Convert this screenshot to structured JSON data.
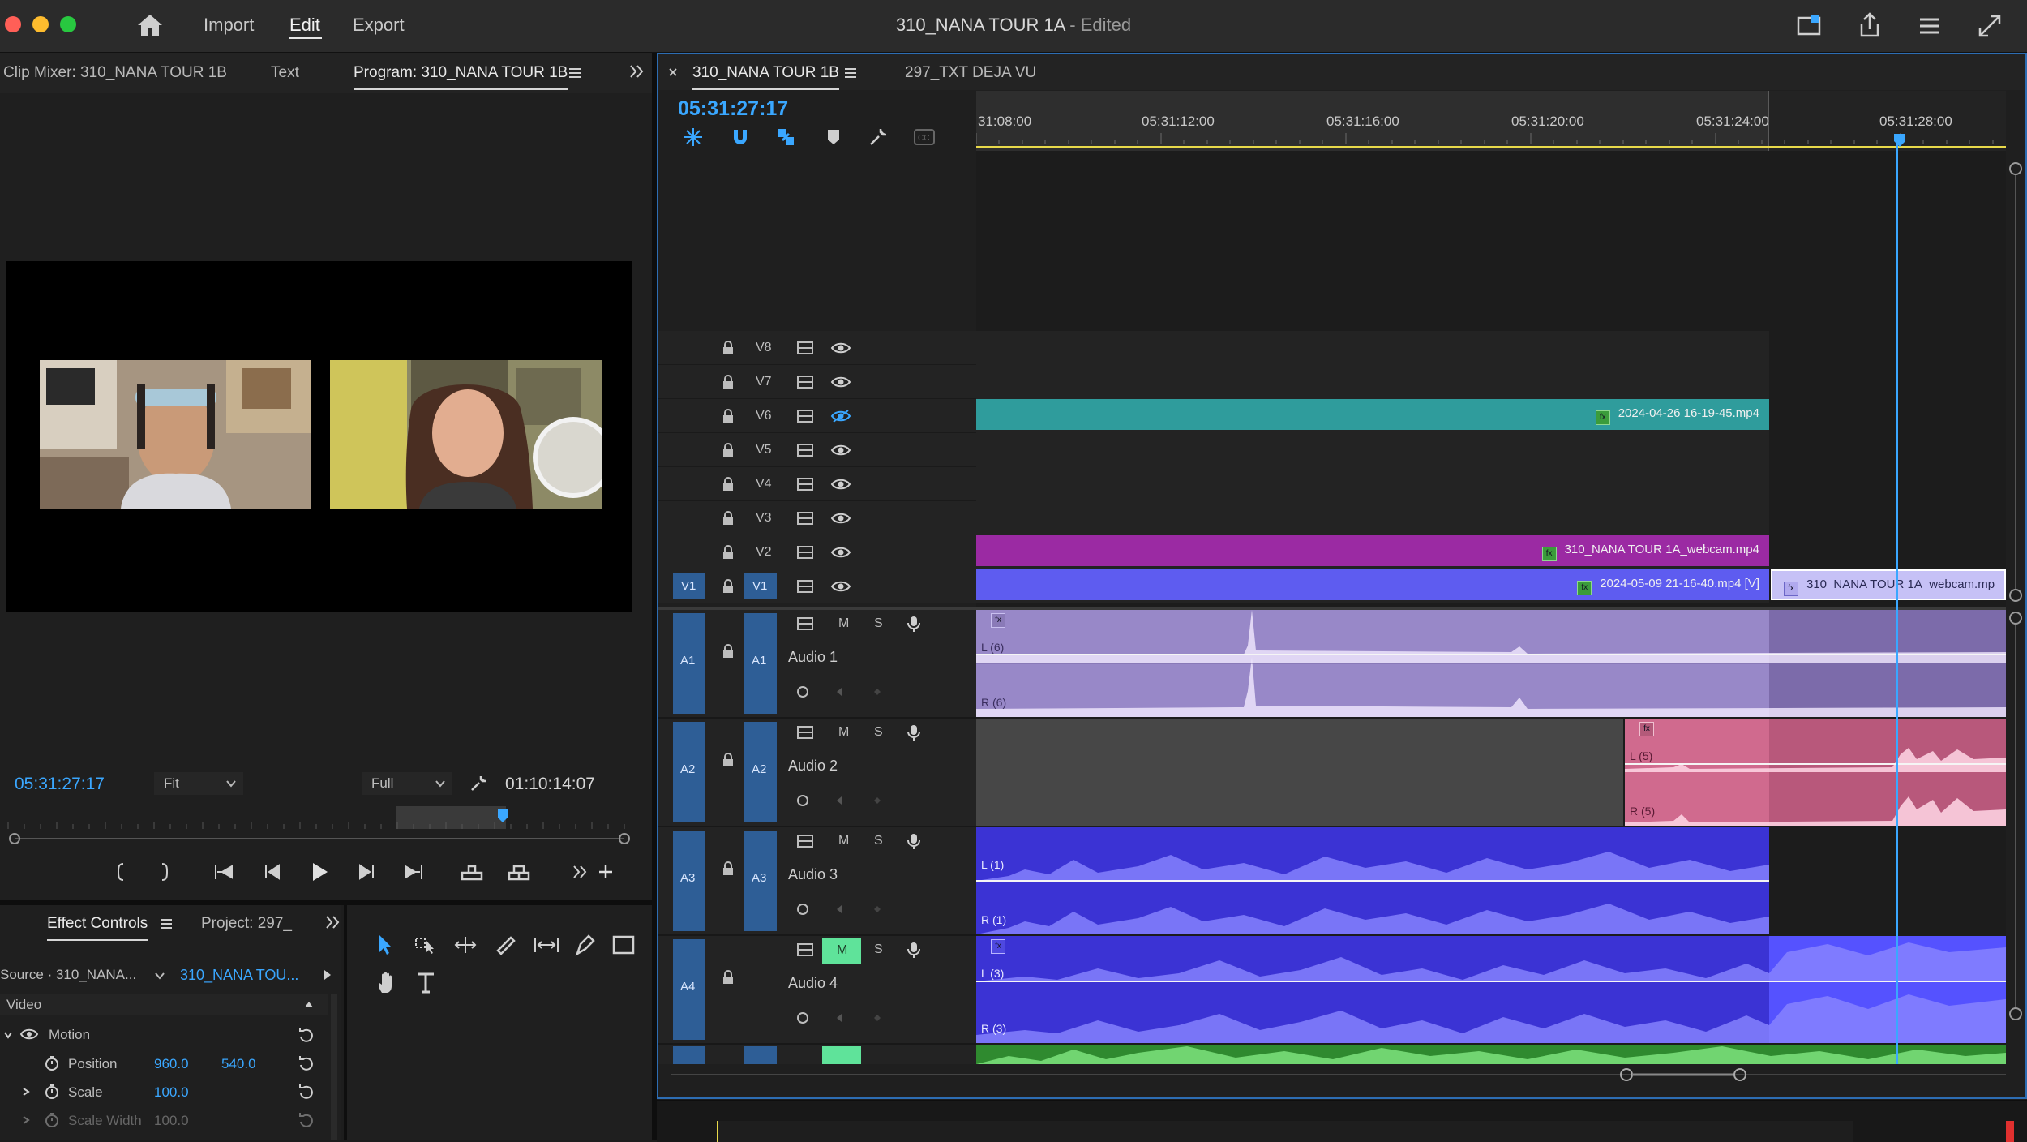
{
  "window": {
    "title": "310_NANA TOUR 1A",
    "title_suffix": "- Edited",
    "menu": [
      "Import",
      "Edit",
      "Export"
    ],
    "active_menu": "Edit"
  },
  "left_panel": {
    "tabs": [
      "Clip Mixer: 310_NANA TOUR 1B",
      "Text",
      "Program: 310_NANA TOUR 1B"
    ],
    "active_tab": "Program: 310_NANA TOUR 1B",
    "timecode": "05:31:27:17",
    "fit_value": "Fit",
    "quality_value": "Full",
    "duration": "01:10:14:07"
  },
  "effect_controls": {
    "tabs": [
      "Effect Controls",
      "Project: 297_"
    ],
    "source_label": "Source · 310_NANA...",
    "sequence_label": "310_NANA TOU...",
    "section": "Video",
    "motion_label": "Motion",
    "properties": [
      {
        "name": "Position",
        "values": [
          "960.0",
          "540.0"
        ]
      },
      {
        "name": "Scale",
        "values": [
          "100.0"
        ]
      },
      {
        "name": "Scale Width",
        "values": [
          "100.0"
        ]
      }
    ]
  },
  "timeline": {
    "tabs": [
      "310_NANA TOUR 1B",
      "297_TXT DEJA VU"
    ],
    "active_tab": "310_NANA TOUR 1B",
    "timecode": "05:31:27:17",
    "ruler_labels": [
      "31:08:00",
      "05:31:12:00",
      "05:31:16:00",
      "05:31:20:00",
      "05:31:24:00",
      "05:31:28:00"
    ],
    "video_tracks": [
      "V8",
      "V7",
      "V6",
      "V5",
      "V4",
      "V3",
      "V2",
      "V1"
    ],
    "source_patch_video": "V1",
    "audio_tracks": [
      {
        "id": "A1",
        "name": "Audio 1"
      },
      {
        "id": "A2",
        "name": "Audio 2"
      },
      {
        "id": "A3",
        "name": "Audio 3"
      },
      {
        "id": "A4",
        "name": "Audio 4"
      }
    ],
    "track_buttons": {
      "mute": "M",
      "solo": "S"
    },
    "clips": {
      "v6": "2024-04-26 16-19-45.mp4",
      "v2": "310_NANA TOUR 1A_webcam.mp4",
      "v1a": "2024-05-09 21-16-40.mp4 [V]",
      "v1b": "310_NANA TOUR 1A_webcam.mp"
    },
    "channel_labels": {
      "a1l": "L (6)",
      "a1r": "R (6)",
      "a2l": "L (5)",
      "a2r": "R (5)",
      "a3l": "L (1)",
      "a3r": "R (1)",
      "a4l": "L (3)",
      "a4r": "R (3)"
    }
  },
  "colors": {
    "accent": "#3aa7ff",
    "v6_clip": "#2f9c9c",
    "v2_clip": "#9b2aa3",
    "v1_clip": "#5e5cf0",
    "audio1": "#9888c8",
    "audio2": "#d06a8e",
    "audio3": "#3b33d4",
    "audio4": "#3b33d4",
    "track_target": "#2e5e96"
  }
}
